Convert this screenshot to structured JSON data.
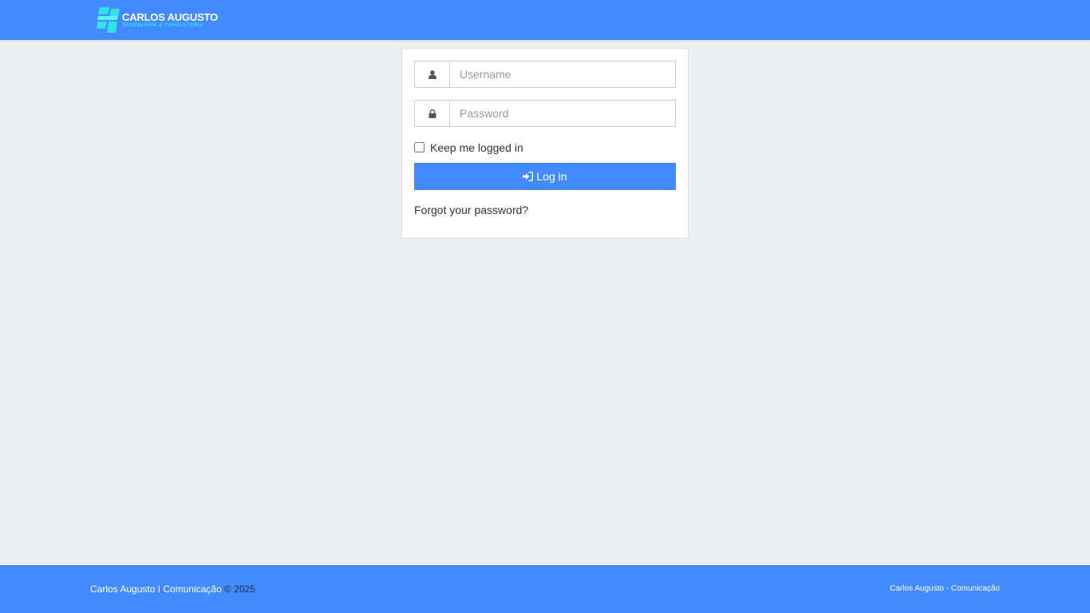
{
  "header": {
    "logo_line1": "CARLOS AUGUSTO",
    "logo_line2": "ASSESSORIA & CONSULTORIA",
    "logo_icon": "building-blocks-logo-icon",
    "background": "#428bff",
    "logo_accent": "#2fe3e8"
  },
  "login": {
    "username_placeholder": "Username",
    "username_value": "",
    "username_icon": "user-icon",
    "password_placeholder": "Password",
    "password_value": "",
    "password_icon": "lock-icon",
    "remember_label": "Keep me logged in",
    "remember_checked": false,
    "submit_label": "Log in",
    "submit_icon": "sign-in-icon",
    "forgot_label": "Forgot your password?"
  },
  "footer": {
    "left_link": "Carlos Augusto I Comunicação",
    "left_suffix": " © 2025",
    "right_text": "Carlos Augusto - Comunicação"
  }
}
